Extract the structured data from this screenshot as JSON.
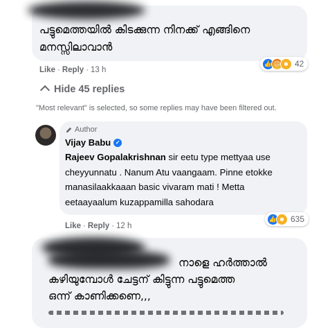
{
  "top_comment": {
    "text_line1": "പട്ടുമെത്തയിൽ കിടക്കുന്ന നിനക്ക് എങ്ങിനെ",
    "text_line2": "മനസ്സിലാവാൻ",
    "like_label": "Like",
    "reply_label": "Reply",
    "time": "13 h",
    "reaction_count": "42",
    "reaction_icons": [
      "like-icon",
      "angry-icon",
      "haha-icon"
    ]
  },
  "replies_toggle": {
    "chevron_icon": "chevron-up-icon",
    "label": "Hide 45 replies"
  },
  "filter_note": "\"Most relevant\" is selected, so some replies may have been filtered out.",
  "author_reply": {
    "badge_icon": "pen-icon",
    "badge_label": "Author",
    "name": "Vijay Babu",
    "verified_icon": "verified-badge-icon",
    "mention": "Rajeev Gopalakrishnan",
    "text_rest": " sir eetu type mettyaa use cheyyunnatu . Nanum Atu vaangaam. Pinne etokke manasilaakkaaan basic vivaram mati ! Metta eetaayaalum kuzappamilla sahodara",
    "like_label": "Like",
    "reply_label": "Reply",
    "time": "12 h",
    "reaction_count": "635",
    "reaction_icons": [
      "like-icon",
      "haha-icon"
    ]
  },
  "bottom_comment": {
    "text_line1": "നാളെ ഹർത്താൽ",
    "text_line2": "കഴിയുമ്പോൾ ചേട്ടന് കിട്ടുന്ന പട്ടുമെത്ത",
    "text_line3": "ഒന്ന് കാണിക്കണെ,,,"
  }
}
